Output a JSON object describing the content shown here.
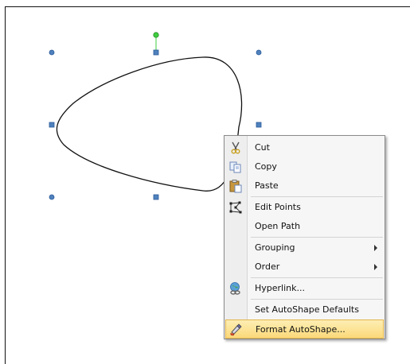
{
  "context_menu": {
    "items": [
      {
        "label": "Cut",
        "icon": "scissors-icon"
      },
      {
        "label": "Copy",
        "icon": "copy-icon"
      },
      {
        "label": "Paste",
        "icon": "paste-icon"
      },
      {
        "label": "Edit Points",
        "icon": "edit-points-icon"
      },
      {
        "label": "Open Path",
        "icon": ""
      },
      {
        "label": "Grouping",
        "icon": "",
        "submenu": true
      },
      {
        "label": "Order",
        "icon": "",
        "submenu": true
      },
      {
        "label": "Hyperlink...",
        "icon": "hyperlink-globe-icon"
      },
      {
        "label": "Set AutoShape Defaults",
        "icon": ""
      },
      {
        "label": "Format AutoShape...",
        "icon": "format-brush-icon",
        "highlighted": true
      }
    ]
  },
  "colors": {
    "handle_fill": "#4f81bd",
    "rotation_handle": "#3ecf3e",
    "highlight": "#fbd97a"
  }
}
